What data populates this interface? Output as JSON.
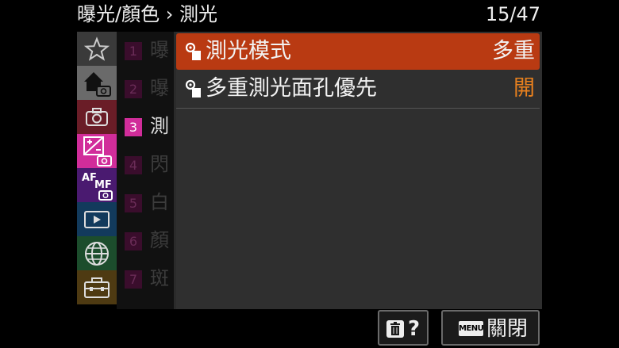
{
  "header": {
    "breadcrumb": "曝光/顏色 › 測光",
    "page_indicator": "15/47"
  },
  "categories": [
    {
      "name": "my-menu",
      "icon": "star-icon",
      "color": "#3a3a3a"
    },
    {
      "name": "main",
      "icon": "home-camera-icon",
      "color": "#6a6a6a"
    },
    {
      "name": "shooting",
      "icon": "camera-icon",
      "color": "#6a1d27"
    },
    {
      "name": "exposure-color",
      "icon": "exposure-camera-icon",
      "color": "#d12d9a"
    },
    {
      "name": "focus",
      "icon": "afmf-camera-icon",
      "color": "#4a1a70"
    },
    {
      "name": "playback",
      "icon": "play-icon",
      "color": "#123a5c"
    },
    {
      "name": "network",
      "icon": "globe-icon",
      "color": "#1c4d2c"
    },
    {
      "name": "setup",
      "icon": "toolbox-icon",
      "color": "#4e3a12"
    }
  ],
  "subpages": [
    {
      "number": "1",
      "char": "曝"
    },
    {
      "number": "2",
      "char": "曝"
    },
    {
      "number": "3",
      "char": "測"
    },
    {
      "number": "4",
      "char": "閃"
    },
    {
      "number": "5",
      "char": "白"
    },
    {
      "number": "6",
      "char": "顏"
    },
    {
      "number": "7",
      "char": "斑"
    }
  ],
  "menu_items": [
    {
      "label": "測光模式",
      "value": "多重"
    },
    {
      "label": "多重測光面孔優先",
      "value": "開"
    }
  ],
  "footer": {
    "delete_help": "?",
    "menu_tag": "MENU",
    "close_label": "關閉"
  },
  "colors": {
    "selected_item": "#b93a12",
    "active_subpage": "#d12d9a",
    "value_orange": "#e8801e"
  }
}
